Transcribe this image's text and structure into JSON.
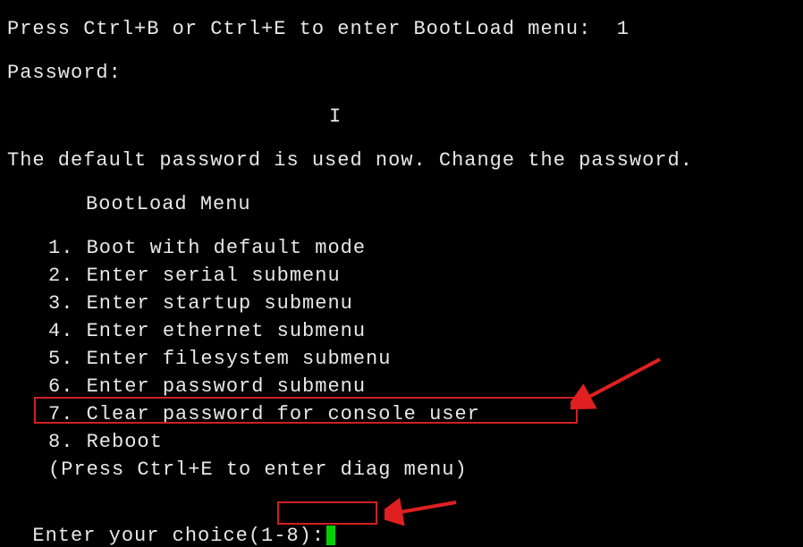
{
  "header": {
    "prompt_line": "Press Ctrl+B or Ctrl+E to enter BootLoad menu:  1",
    "password_label": "Password:",
    "cursor_char": "I",
    "password_notice": "The default password is used now. Change the password."
  },
  "menu": {
    "title": "BootLoad Menu",
    "items": [
      "1. Boot with default mode",
      "2. Enter serial submenu",
      "3. Enter startup submenu",
      "4. Enter ethernet submenu",
      "5. Enter filesystem submenu",
      "6. Enter password submenu",
      "7. Clear password for console user",
      "8. Reboot"
    ],
    "hint": "(Press Ctrl+E to enter diag menu)"
  },
  "input": {
    "prompt": "Enter your choice(1-8):"
  },
  "annotations": {
    "arrow_color": "#e02020",
    "highlight_color": "#d02020",
    "cursor_color": "#00d000"
  }
}
